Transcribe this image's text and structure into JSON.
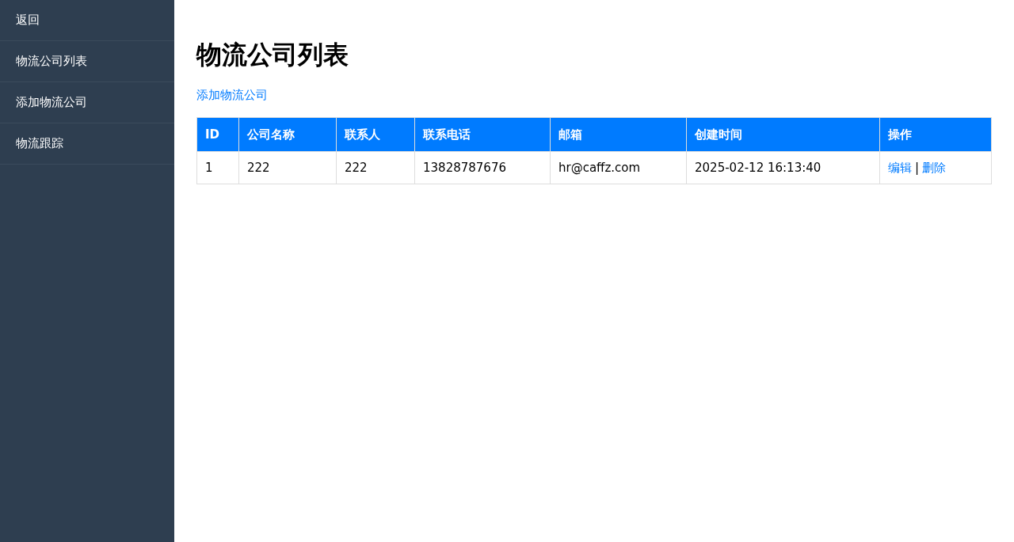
{
  "sidebar": {
    "items": [
      {
        "label": "返回"
      },
      {
        "label": "物流公司列表"
      },
      {
        "label": "添加物流公司"
      },
      {
        "label": "物流跟踪"
      }
    ]
  },
  "page": {
    "title": "物流公司列表",
    "add_link": "添加物流公司"
  },
  "table": {
    "columns": [
      "ID",
      "公司名称",
      "联系人",
      "联系电话",
      "邮箱",
      "创建时间",
      "操作"
    ],
    "rows": [
      {
        "cells": [
          "1",
          "222",
          "222",
          "13828787676",
          "hr@caffz.com",
          "2025-02-12 16:13:40"
        ],
        "actions": {
          "edit": "编辑",
          "separator": "|",
          "delete": "删除"
        }
      }
    ]
  }
}
